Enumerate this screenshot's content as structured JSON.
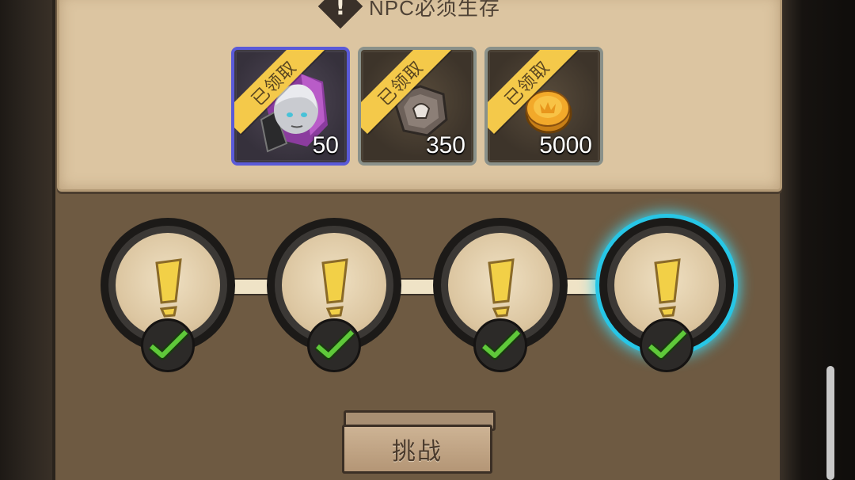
{
  "header": {
    "title": "NPC必须生存",
    "warning_icon": "!"
  },
  "rewards": [
    {
      "status": "已领取",
      "amount": "50",
      "icon": "hooded-hero-icon",
      "border": "#5a5ad8"
    },
    {
      "status": "已领取",
      "amount": "350",
      "icon": "stone-gem-icon",
      "border": "#8a918a"
    },
    {
      "status": "已领取",
      "amount": "5000",
      "icon": "gold-coin-icon",
      "border": "#8a918a"
    }
  ],
  "stages": [
    {
      "icon": "exclamation-icon",
      "completed": true,
      "active": false
    },
    {
      "icon": "exclamation-icon",
      "completed": true,
      "active": false
    },
    {
      "icon": "exclamation-icon",
      "completed": true,
      "active": false
    },
    {
      "icon": "exclamation-icon",
      "completed": true,
      "active": true
    }
  ],
  "actions": {
    "challenge_label": "挑战"
  },
  "colors": {
    "active_glow": "#3fd8f3",
    "ribbon": "#f4c94a",
    "check": "#5fc93a"
  }
}
